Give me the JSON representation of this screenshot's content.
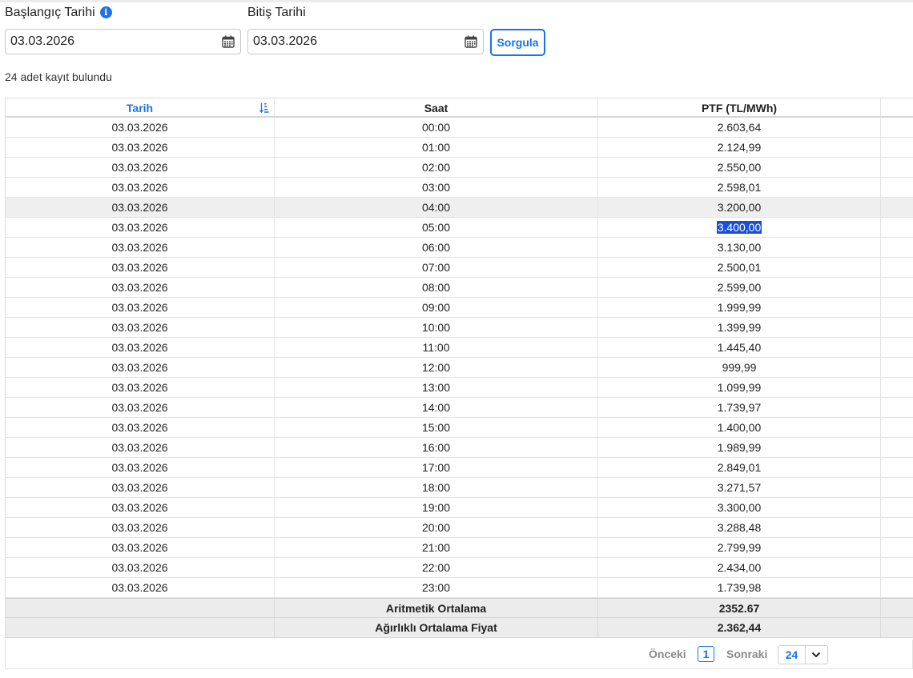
{
  "filters": {
    "start_label": "Başlangıç Tarihi",
    "start_value": "03.03.2026",
    "end_label": "Bitiş Tarihi",
    "end_value": "03.03.2026",
    "query_button": "Sorgula"
  },
  "record_count": "24 adet kayıt bulundu",
  "table": {
    "columns": [
      "Tarih",
      "Saat",
      "PTF (TL/MWh)",
      ""
    ],
    "sort_icon": "sort-ascending-icon",
    "rows": [
      [
        "03.03.2026",
        "00:00",
        "2.603,64"
      ],
      [
        "03.03.2026",
        "01:00",
        "2.124,99"
      ],
      [
        "03.03.2026",
        "02:00",
        "2.550,00"
      ],
      [
        "03.03.2026",
        "03:00",
        "2.598,01"
      ],
      [
        "03.03.2026",
        "04:00",
        "3.200,00"
      ],
      [
        "03.03.2026",
        "05:00",
        "3.400,00"
      ],
      [
        "03.03.2026",
        "06:00",
        "3.130,00"
      ],
      [
        "03.03.2026",
        "07:00",
        "2.500,01"
      ],
      [
        "03.03.2026",
        "08:00",
        "2.599,00"
      ],
      [
        "03.03.2026",
        "09:00",
        "1.999,99"
      ],
      [
        "03.03.2026",
        "10:00",
        "1.399,99"
      ],
      [
        "03.03.2026",
        "11:00",
        "1.445,40"
      ],
      [
        "03.03.2026",
        "12:00",
        "999,99"
      ],
      [
        "03.03.2026",
        "13:00",
        "1.099,99"
      ],
      [
        "03.03.2026",
        "14:00",
        "1.739,97"
      ],
      [
        "03.03.2026",
        "15:00",
        "1.400,00"
      ],
      [
        "03.03.2026",
        "16:00",
        "1.989,99"
      ],
      [
        "03.03.2026",
        "17:00",
        "2.849,01"
      ],
      [
        "03.03.2026",
        "18:00",
        "3.271,57"
      ],
      [
        "03.03.2026",
        "19:00",
        "3.300,00"
      ],
      [
        "03.03.2026",
        "20:00",
        "3.288,48"
      ],
      [
        "03.03.2026",
        "21:00",
        "2.799,99"
      ],
      [
        "03.03.2026",
        "22:00",
        "2.434,00"
      ],
      [
        "03.03.2026",
        "23:00",
        "1.739,98"
      ]
    ],
    "hovered_row": 4,
    "selected_row": 5,
    "summary": [
      {
        "label": "Aritmetik Ortalama",
        "value": "2352.67"
      },
      {
        "label": "Ağırlıklı Ortalama Fiyat",
        "value": "2.362,44"
      }
    ]
  },
  "pager": {
    "prev": "Önceki",
    "current": "1",
    "next": "Sonraki",
    "page_size": "24"
  },
  "colors": {
    "accent": "#1a73e8",
    "selection": "#1a4fd6"
  }
}
